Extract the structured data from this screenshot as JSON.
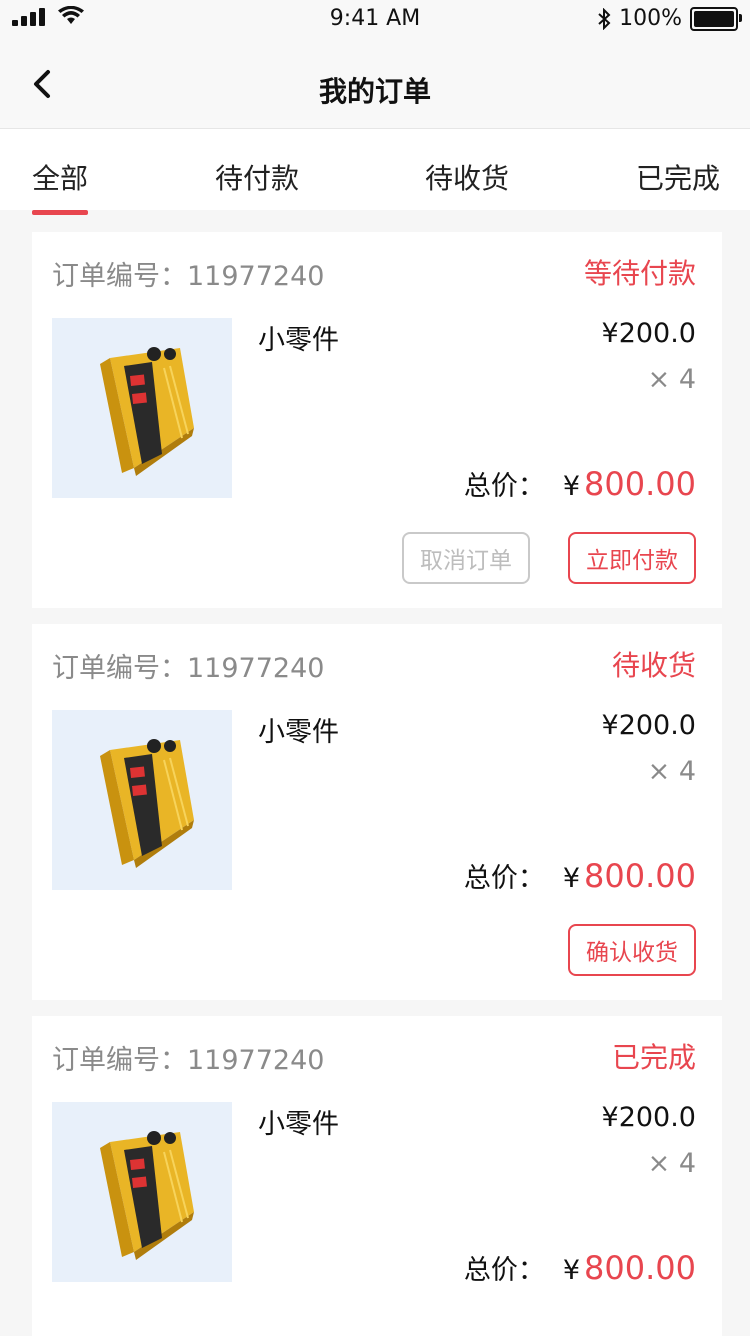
{
  "status_bar": {
    "time": "9:41 AM",
    "battery": "100%",
    "icons": [
      "signal-icon",
      "wifi-icon",
      "bluetooth-icon",
      "battery-icon"
    ]
  },
  "nav": {
    "title": "我的订单",
    "back_icon": "chevron-left-icon"
  },
  "tabs": [
    {
      "label": "全部",
      "active": true
    },
    {
      "label": "待付款",
      "active": false
    },
    {
      "label": "待收货",
      "active": false
    },
    {
      "label": "已完成",
      "active": false
    }
  ],
  "colors": {
    "accent": "#e8464f",
    "background": "#f6f6f6",
    "muted": "#8a8a8a",
    "image_bg": "#e8f0fa"
  },
  "orders": [
    {
      "id_label": "订单编号：",
      "id": "11977240",
      "status": "等待付款",
      "product": {
        "name": "小零件",
        "price": "¥200.0",
        "qty": "× 4",
        "image_icon": "voltage-regulator-product-image"
      },
      "total_label": "总价：",
      "total_currency": "¥",
      "total_amount": "800.00",
      "actions": {
        "cancel": "取消订单",
        "primary": "立即付款"
      }
    },
    {
      "id_label": "订单编号：",
      "id": "11977240",
      "status": "待收货",
      "product": {
        "name": "小零件",
        "price": "¥200.0",
        "qty": "× 4",
        "image_icon": "voltage-regulator-product-image"
      },
      "total_label": "总价：",
      "total_currency": "¥",
      "total_amount": "800.00",
      "actions": {
        "primary": "确认收货"
      }
    },
    {
      "id_label": "订单编号：",
      "id": "11977240",
      "status": "已完成",
      "product": {
        "name": "小零件",
        "price": "¥200.0",
        "qty": "× 4",
        "image_icon": "voltage-regulator-product-image"
      },
      "total_label": "总价：",
      "total_currency": "¥",
      "total_amount": "800.00"
    }
  ]
}
